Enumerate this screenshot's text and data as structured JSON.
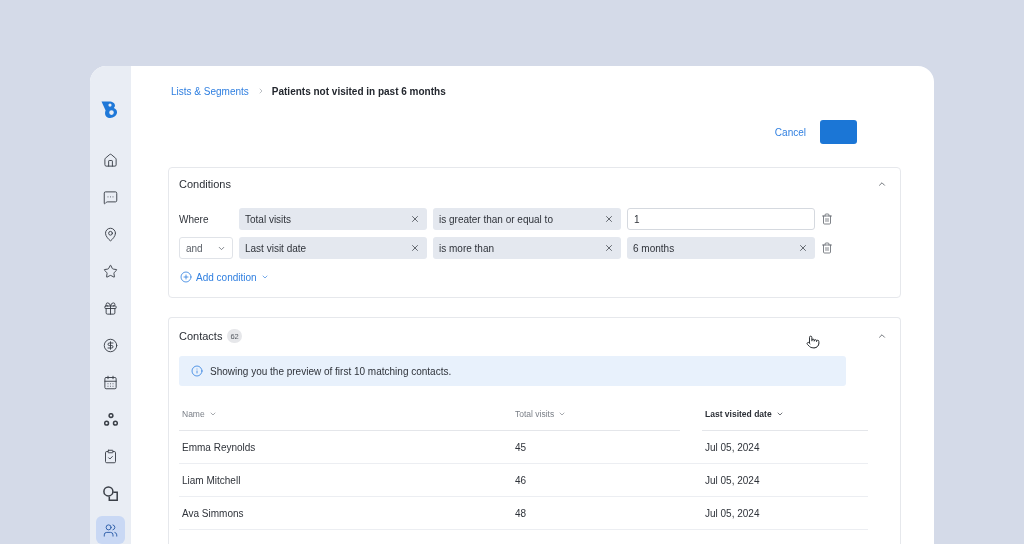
{
  "sidebar": {
    "items": [
      {
        "selected": false
      },
      {
        "selected": false
      },
      {
        "selected": false
      },
      {
        "selected": false
      },
      {
        "selected": false
      },
      {
        "selected": false
      },
      {
        "selected": false
      },
      {
        "selected": false
      },
      {
        "selected": false
      },
      {
        "selected": false
      },
      {
        "selected": true
      }
    ]
  },
  "breadcrumb": [
    {
      "kind": "link",
      "label": "Lists & Segments"
    },
    {
      "kind": "current",
      "label": "Patients not visited in past 6 months"
    }
  ],
  "actions": {
    "cancel": "Cancel"
  },
  "conditions": {
    "title": "Conditions",
    "expanded": true,
    "rows": [
      {
        "connector": {
          "kind": "label",
          "text": "Where"
        },
        "field": "Total visits",
        "operator": "is greater than or equal to",
        "value": {
          "kind": "input",
          "text": "1"
        }
      },
      {
        "connector": {
          "kind": "select",
          "text": "and"
        },
        "field": "Last visit date",
        "operator": "is more than",
        "value": {
          "kind": "chip",
          "text": "6 months"
        }
      }
    ],
    "add_label": "Add condition"
  },
  "contacts": {
    "title": "Contacts",
    "count": "62",
    "expanded": true,
    "notice": "Showing you the preview of first 10 matching contacts.",
    "table": {
      "columns": [
        {
          "label": "Name",
          "sorted": false
        },
        {
          "label": "Total visits",
          "sorted": false
        },
        {
          "label": "Last visited date",
          "sorted": true
        }
      ],
      "rows": [
        [
          "Emma Reynolds",
          "45",
          "Jul 05, 2024"
        ],
        [
          "Liam Mitchell",
          "46",
          "Jul 05, 2024"
        ],
        [
          "Ava Simmons",
          "48",
          "Jul 05, 2024"
        ]
      ]
    }
  }
}
